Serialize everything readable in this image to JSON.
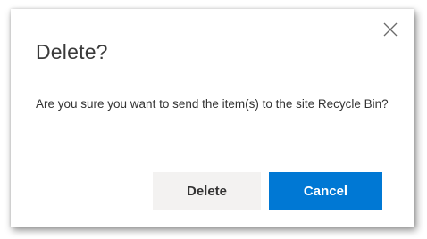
{
  "dialog": {
    "title": "Delete?",
    "message": "Are you sure you want to send the item(s) to the site Recycle Bin?",
    "close_icon": "close-icon",
    "buttons": {
      "delete_label": "Delete",
      "cancel_label": "Cancel"
    }
  },
  "colors": {
    "primary_button": "#0078d4",
    "secondary_button": "#f3f2f1",
    "title_text": "#3a3a3a",
    "body_text": "#333333"
  }
}
